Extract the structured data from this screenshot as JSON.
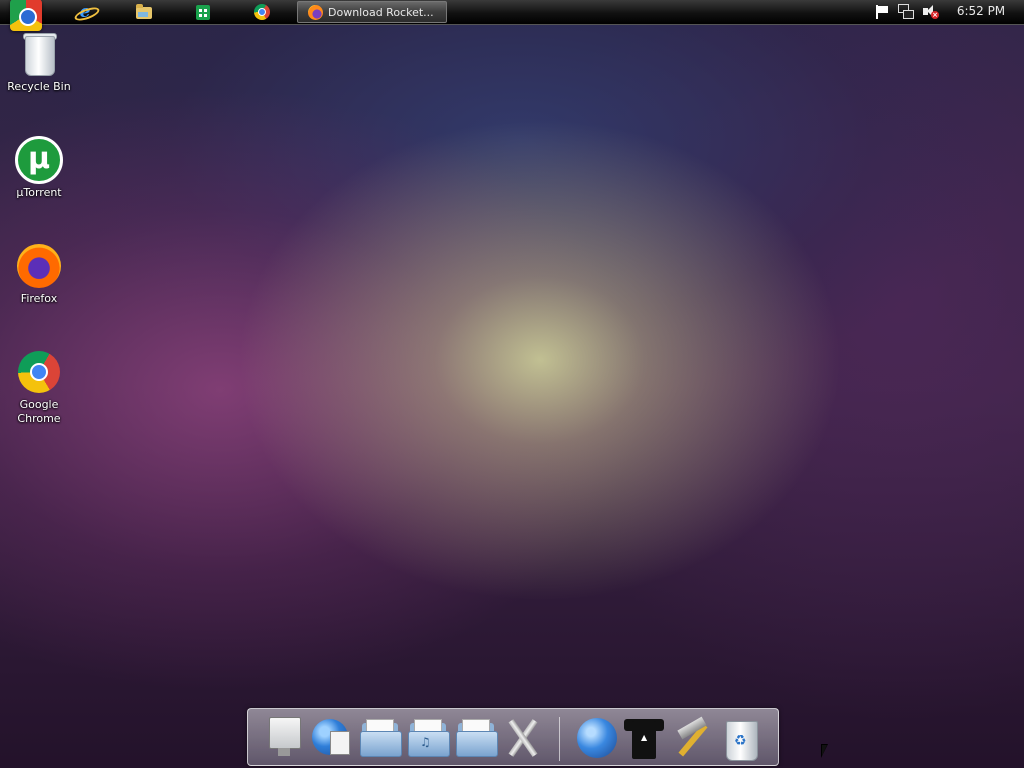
{
  "taskbar": {
    "pinned": [
      {
        "name": "internet-explorer",
        "icon": "ie-icon"
      },
      {
        "name": "file-explorer",
        "icon": "folder-icon"
      },
      {
        "name": "windows-store",
        "icon": "store-icon"
      },
      {
        "name": "google-chrome",
        "icon": "chrome-icon"
      }
    ],
    "active_task": {
      "label": "Download Rocket...",
      "icon": "firefox-icon"
    },
    "tray": {
      "icons": [
        "action-center-flag-icon",
        "network-icon",
        "volume-muted-icon"
      ],
      "clock": "6:52 PM"
    }
  },
  "desktop": {
    "icons": [
      {
        "label": "Recycle Bin",
        "icon": "recycle-bin-icon"
      },
      {
        "label": "µTorrent",
        "icon": "utorrent-icon"
      },
      {
        "label": "Firefox",
        "icon": "firefox-icon"
      },
      {
        "label": "Google\nChrome",
        "icon": "chrome-icon"
      }
    ]
  },
  "dock": {
    "items": [
      "monitor-icon",
      "globe-document-icon",
      "documents-folder-icon",
      "music-folder-icon",
      "pictures-folder-icon",
      "tools-icon",
      "globe-arrow-icon",
      "tshirt-icon",
      "hammer-icon",
      "trash-icon"
    ]
  },
  "colors": {
    "taskbar_bg": "#111111",
    "desktop_glow": "#c8c896",
    "desktop_purple": "#7a3a6e"
  }
}
